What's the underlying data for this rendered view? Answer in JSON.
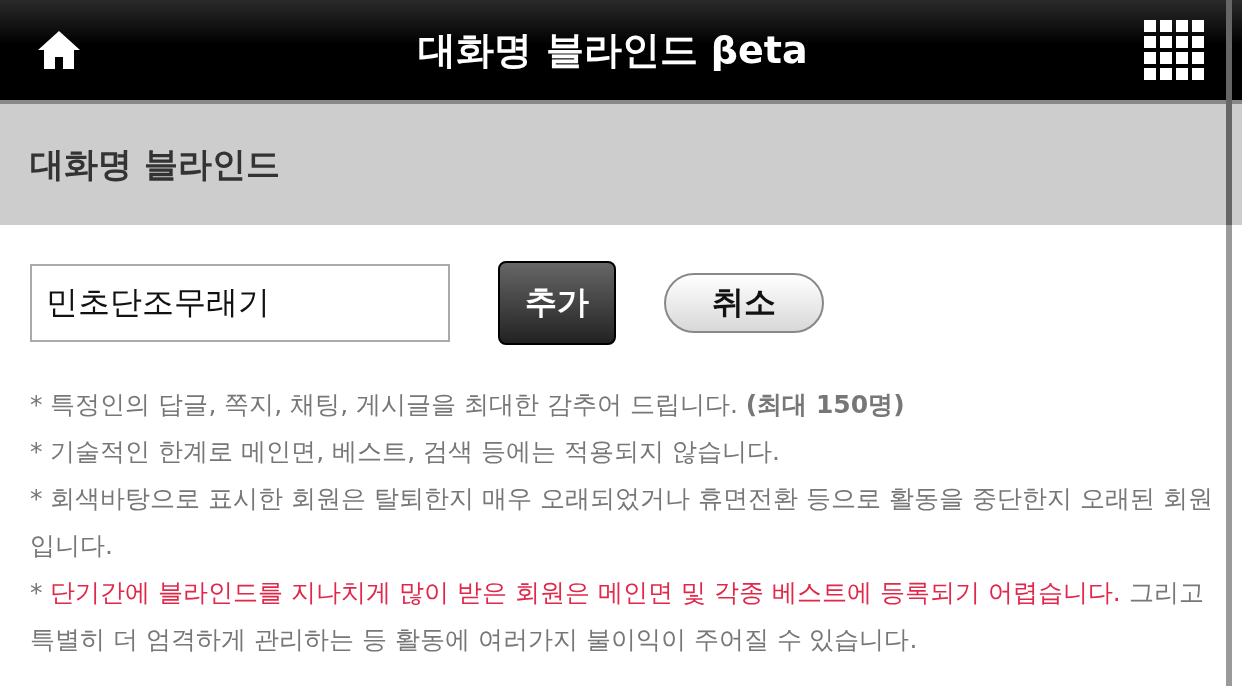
{
  "header": {
    "title": "대화명 블라인드 βeta"
  },
  "section": {
    "title": "대화명 블라인드"
  },
  "form": {
    "value": "민초단조무래기",
    "buttons": [
      {
        "label": "추가",
        "kind": "primary"
      },
      {
        "label": "취소",
        "kind": "secondary"
      }
    ]
  },
  "notes": [
    [
      {
        "text": "* 특정인의 답글, 쪽지, 채팅, 게시글을 최대한 감추어 드립니다. **(최대 150명)**",
        "highlight": false
      }
    ],
    [
      {
        "text": "* 기술적인 한계로 메인면, 베스트, 검색 등에는 적용되지 않습니다.",
        "highlight": false
      }
    ],
    [
      {
        "text": "* 회색바탕으로 표시한 회원은 탈퇴한지 매우 오래되었거나 휴면전환 등으로 활동을 중단한지 오래된 회원입니다.",
        "highlight": false
      }
    ],
    [
      {
        "text": "* ",
        "highlight": false
      },
      {
        "text": "단기간에 블라인드를 지나치게 많이 받은 회원은 메인면 및 각종 베스트에 등록되기 어렵습니다.",
        "highlight": true
      },
      {
        "text": " 그리고 특별히 더 엄격하게 관리하는 등 활동에 여러가지 불이익이 주어질 수 있습니다.",
        "highlight": false
      }
    ]
  ]
}
